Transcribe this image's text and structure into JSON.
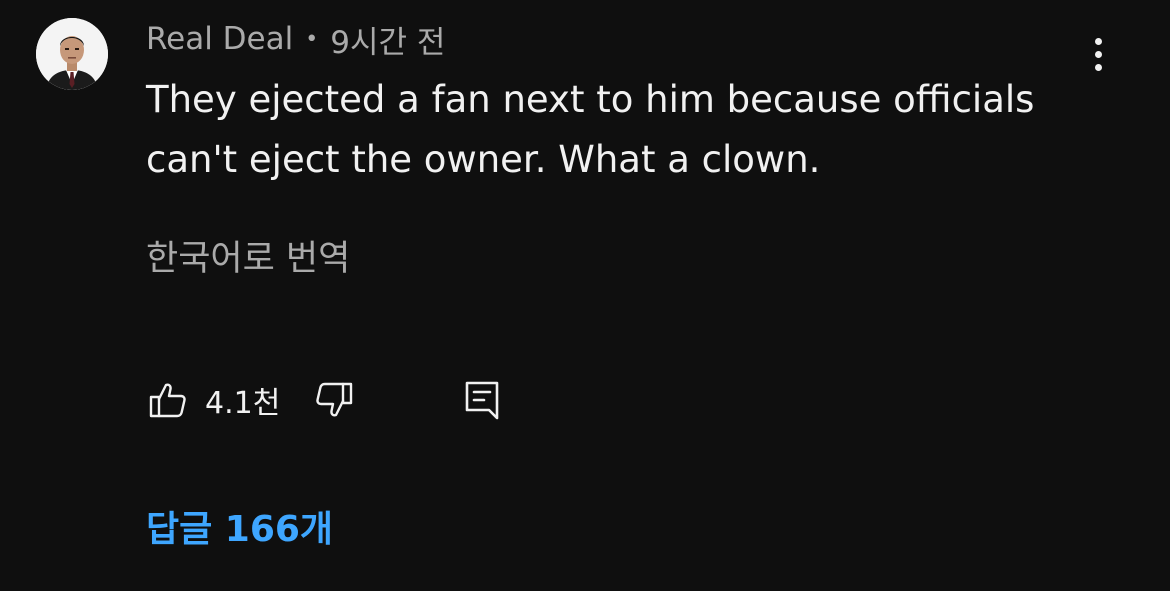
{
  "comment": {
    "author": "Real Deal",
    "separator": "•",
    "time": "9시간 전",
    "text": "They ejected a fan next to him because officials can't eject the owner. What a clown.",
    "translate_label": "한국어로 번역",
    "like_count": "4.1천",
    "replies_label": "답글 166개"
  },
  "icons": {
    "more": "more-vert-icon",
    "like": "thumb-up-icon",
    "dislike": "thumb-down-icon",
    "reply": "comment-icon"
  },
  "colors": {
    "background": "#0f0f0f",
    "text_primary": "#f1f1f1",
    "text_secondary": "#aaaaaa",
    "link_blue": "#3ea6ff"
  }
}
